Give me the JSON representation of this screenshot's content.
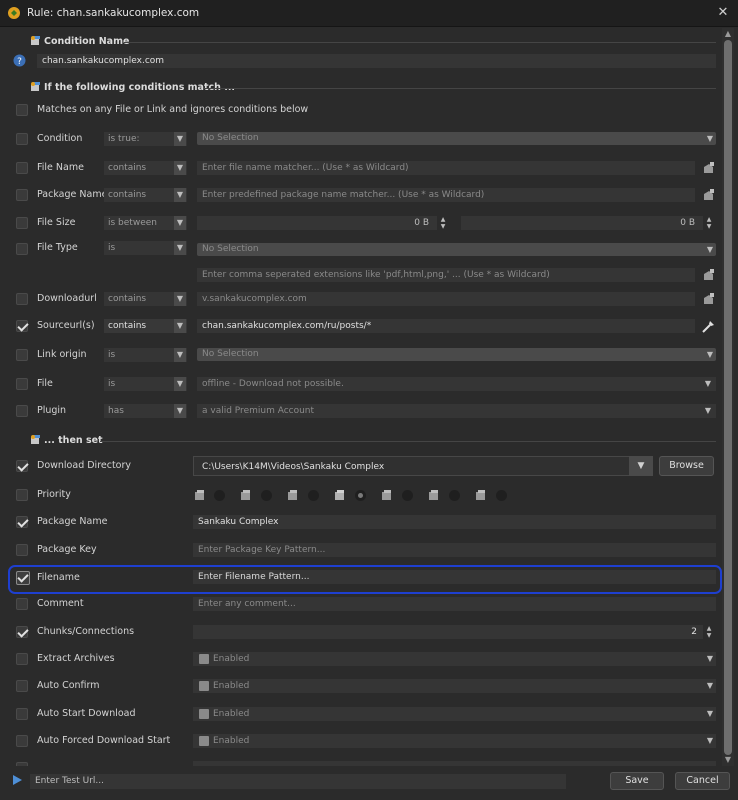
{
  "window": {
    "title": "Rule: chan.sankakucomplex.com"
  },
  "sections": {
    "condition_name": "Condition Name",
    "if_conditions": "If the following conditions match ...",
    "then_set": "... then set"
  },
  "condition_name_value": "chan.sankakucomplex.com",
  "matches_any": "Matches on any File or Link and ignores conditions below",
  "conditions": {
    "condition": {
      "label": "Condition",
      "op": "is true:",
      "value": "No Selection",
      "checked": false
    },
    "file_name": {
      "label": "File Name",
      "op": "contains",
      "placeholder": "Enter file name matcher... (Use * as Wildcard)",
      "checked": false
    },
    "package_name": {
      "label": "Package Name",
      "op": "contains",
      "placeholder": "Enter predefined package name matcher... (Use * as Wildcard)",
      "checked": false
    },
    "file_size": {
      "label": "File Size",
      "op": "is between",
      "min": "0 B",
      "max": "0 B",
      "checked": false
    },
    "file_type": {
      "label": "File Type",
      "op": "is",
      "value": "No Selection",
      "ext_placeholder": "Enter comma seperated extensions like 'pdf,html,png,' ... (Use * as Wildcard)",
      "checked": false
    },
    "downloadurl": {
      "label": "Downloadurl",
      "op": "contains",
      "value": "v.sankakucomplex.com",
      "checked": false
    },
    "sourceurls": {
      "label": "Sourceurl(s)",
      "op": "contains",
      "value": "chan.sankakucomplex.com/ru/posts/*",
      "checked": true
    },
    "link_origin": {
      "label": "Link origin",
      "op": "is",
      "value": "No Selection",
      "checked": false
    },
    "file": {
      "label": "File",
      "op": "is",
      "value": "offline - Download not possible.",
      "checked": false
    },
    "plugin": {
      "label": "Plugin",
      "op": "has",
      "value": "a valid Premium Account",
      "checked": false
    }
  },
  "actions": {
    "download_directory": {
      "label": "Download Directory",
      "value": "C:\\Users\\K14M\\Videos\\Sankaku Complex",
      "browse": "Browse",
      "checked": true
    },
    "priority": {
      "label": "Priority",
      "checked": false,
      "selected_index": 3
    },
    "package_name": {
      "label": "Package Name",
      "value": "Sankaku Complex",
      "checked": true
    },
    "package_key": {
      "label": "Package Key",
      "placeholder": "Enter Package Key Pattern...",
      "checked": false
    },
    "filename": {
      "label": "Filename",
      "placeholder": "Enter Filename Pattern...",
      "checked": true
    },
    "comment": {
      "label": "Comment",
      "placeholder": "Enter any comment...",
      "checked": false
    },
    "chunks": {
      "label": "Chunks/Connections",
      "value": "2",
      "checked": true
    },
    "extract_archives": {
      "label": "Extract Archives",
      "value": "Enabled",
      "checked": false
    },
    "auto_confirm": {
      "label": "Auto Confirm",
      "value": "Enabled",
      "checked": false
    },
    "auto_start": {
      "label": "Auto Start Download",
      "value": "Enabled",
      "checked": false
    },
    "auto_forced": {
      "label": "Auto Forced Download Start",
      "value": "Enabled",
      "checked": false
    }
  },
  "bottom": {
    "test_url_placeholder": "Enter Test Url...",
    "save": "Save",
    "cancel": "Cancel"
  },
  "colors": {
    "accent_highlight": "#1e3fd0",
    "background": "#2b2b2b",
    "field": "#353535"
  },
  "icons": [
    "app-icon",
    "close-icon",
    "help-icon",
    "rules-icon",
    "checkbox-icon",
    "dropdown-arrow-icon",
    "spinner-icon",
    "pick-icon",
    "priority-icon",
    "play-icon"
  ]
}
